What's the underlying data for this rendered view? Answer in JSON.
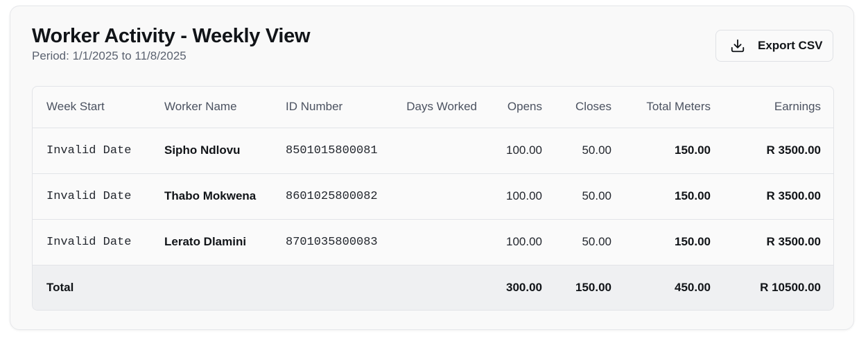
{
  "header": {
    "title": "Worker Activity - Weekly View",
    "period": "Period: 1/1/2025 to 11/8/2025",
    "export_label": "Export CSV"
  },
  "icons": {
    "export": "download-icon"
  },
  "table": {
    "columns": {
      "week_start": "Week Start",
      "worker_name": "Worker Name",
      "id_number": "ID Number",
      "days_worked": "Days Worked",
      "opens": "Opens",
      "closes": "Closes",
      "total_meters": "Total Meters",
      "earnings": "Earnings"
    },
    "rows": [
      {
        "week_start": "Invalid Date",
        "worker_name": "Sipho Ndlovu",
        "id_number": "8501015800081",
        "days_worked": "",
        "opens": "100.00",
        "closes": "50.00",
        "total_meters": "150.00",
        "earnings": "R 3500.00"
      },
      {
        "week_start": "Invalid Date",
        "worker_name": "Thabo Mokwena",
        "id_number": "8601025800082",
        "days_worked": "",
        "opens": "100.00",
        "closes": "50.00",
        "total_meters": "150.00",
        "earnings": "R 3500.00"
      },
      {
        "week_start": "Invalid Date",
        "worker_name": "Lerato Dlamini",
        "id_number": "8701035800083",
        "days_worked": "",
        "opens": "100.00",
        "closes": "50.00",
        "total_meters": "150.00",
        "earnings": "R 3500.00"
      }
    ],
    "total": {
      "label": "Total",
      "opens": "300.00",
      "closes": "150.00",
      "total_meters": "450.00",
      "earnings": "R 10500.00"
    }
  }
}
